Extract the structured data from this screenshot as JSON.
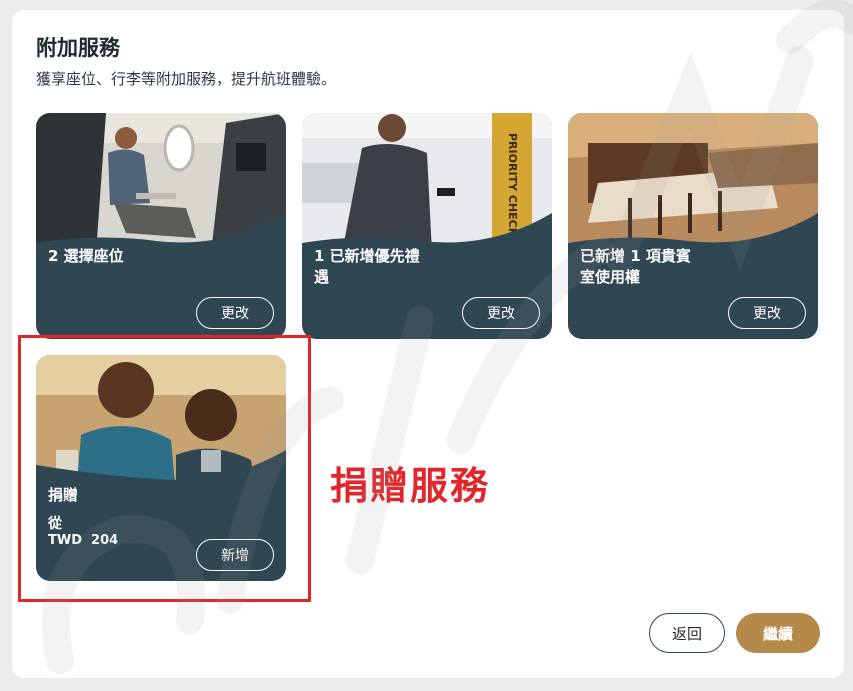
{
  "section": {
    "title": "附加服務",
    "subtitle": "獲享座位、行李等附加服務，提升航班體驗。"
  },
  "cards": [
    {
      "title": "2 選擇座位",
      "button": "更改",
      "image": "seat-photo"
    },
    {
      "title": "1 已新增優先禮遇",
      "button": "更改",
      "image": "priority-checkin-photo",
      "sign_text": "PRIORITY CHECK-IN"
    },
    {
      "title": "已新增 1 項貴賓室使用權",
      "button": "更改",
      "image": "lounge-photo"
    },
    {
      "title": "捐贈",
      "from": "從",
      "price": "TWD  204",
      "button": "新增",
      "image": "children-photo"
    }
  ],
  "annotation": "捐贈服務",
  "footer": {
    "back": "返回",
    "continue": "繼續"
  },
  "colors": {
    "card": "#2f4653",
    "accent": "#b5894a",
    "highlight": "#e0262b"
  }
}
